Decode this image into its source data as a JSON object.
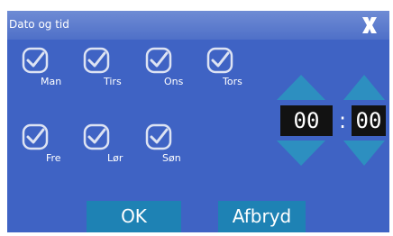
{
  "window": {
    "title": "Dato og tid",
    "close_label": "X"
  },
  "days": [
    {
      "label": "Man",
      "checked": true
    },
    {
      "label": "Tirs",
      "checked": true
    },
    {
      "label": "Ons",
      "checked": true
    },
    {
      "label": "Tors",
      "checked": true
    },
    {
      "label": "Fre",
      "checked": true
    },
    {
      "label": "Lør",
      "checked": true
    },
    {
      "label": "Søn",
      "checked": true
    }
  ],
  "time": {
    "hours": "00",
    "separator": ":",
    "minutes": "00"
  },
  "buttons": {
    "ok": "OK",
    "cancel": "Afbryd"
  },
  "colors": {
    "panel": "#3f63c4",
    "titlebar": "#5a7ccc",
    "arrow": "#2d8fc0",
    "button": "#1e82b4"
  }
}
